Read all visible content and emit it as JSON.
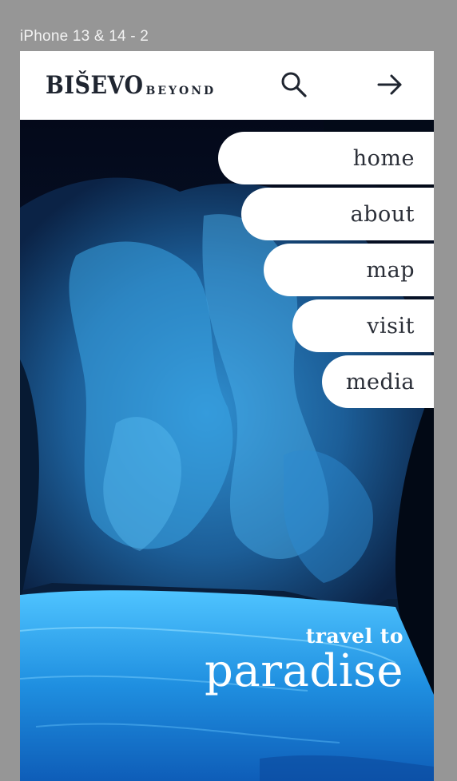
{
  "canvas": {
    "frame_label": "iPhone 13 & 14 - 2"
  },
  "header": {
    "logo_main": "BIŠEVO",
    "logo_sub": "BEYOND",
    "search_icon": "search-icon",
    "arrow_icon": "arrow-right-icon"
  },
  "nav": {
    "items": [
      {
        "label": "home"
      },
      {
        "label": "about"
      },
      {
        "label": "map"
      },
      {
        "label": "visit"
      },
      {
        "label": "media"
      }
    ]
  },
  "hero": {
    "tagline_small": "travel to",
    "tagline_big": "paradise"
  },
  "colors": {
    "canvas_bg": "#969696",
    "header_bg": "#ffffff",
    "logo_color": "#1f2530",
    "water": "#2aa7f0",
    "rock": "#1f5f96",
    "nav_text": "#2b2f38"
  }
}
